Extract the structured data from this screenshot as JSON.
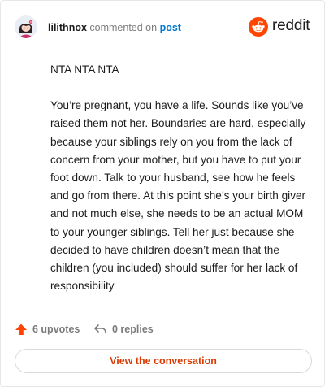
{
  "header": {
    "username": "lilithnox",
    "action_text": "commented on",
    "target_link": "post",
    "brand_name": "reddit"
  },
  "comment": {
    "paragraphs": [
      "NTA NTA NTA",
      "You’re pregnant, you have a life. Sounds like you’ve raised them not her. Boundaries are hard, especially because your siblings rely on you from the lack of concern from your mother, but you have to put your foot down. Talk to your husband, see how he feels and go from there. At this point she’s your birth giver and not much else, she needs to be an actual MOM to your younger siblings. Tell her just because she decided to have children doesn’t mean that the children (you included) should suffer for her lack of responsibility"
    ]
  },
  "actions": {
    "upvotes": "6 upvotes",
    "replies": "0 replies"
  },
  "cta": {
    "label": "View the conversation"
  },
  "colors": {
    "brand_orange": "#ff4500",
    "link_blue": "#0079d3",
    "cta_text": "#d93a00",
    "muted": "#7c7c7c",
    "text": "#1c1c1c"
  },
  "icons": {
    "avatar": "user-avatar",
    "brand": "reddit-snoo-icon",
    "upvote": "upvote-arrow-icon",
    "reply": "reply-arrow-icon"
  }
}
